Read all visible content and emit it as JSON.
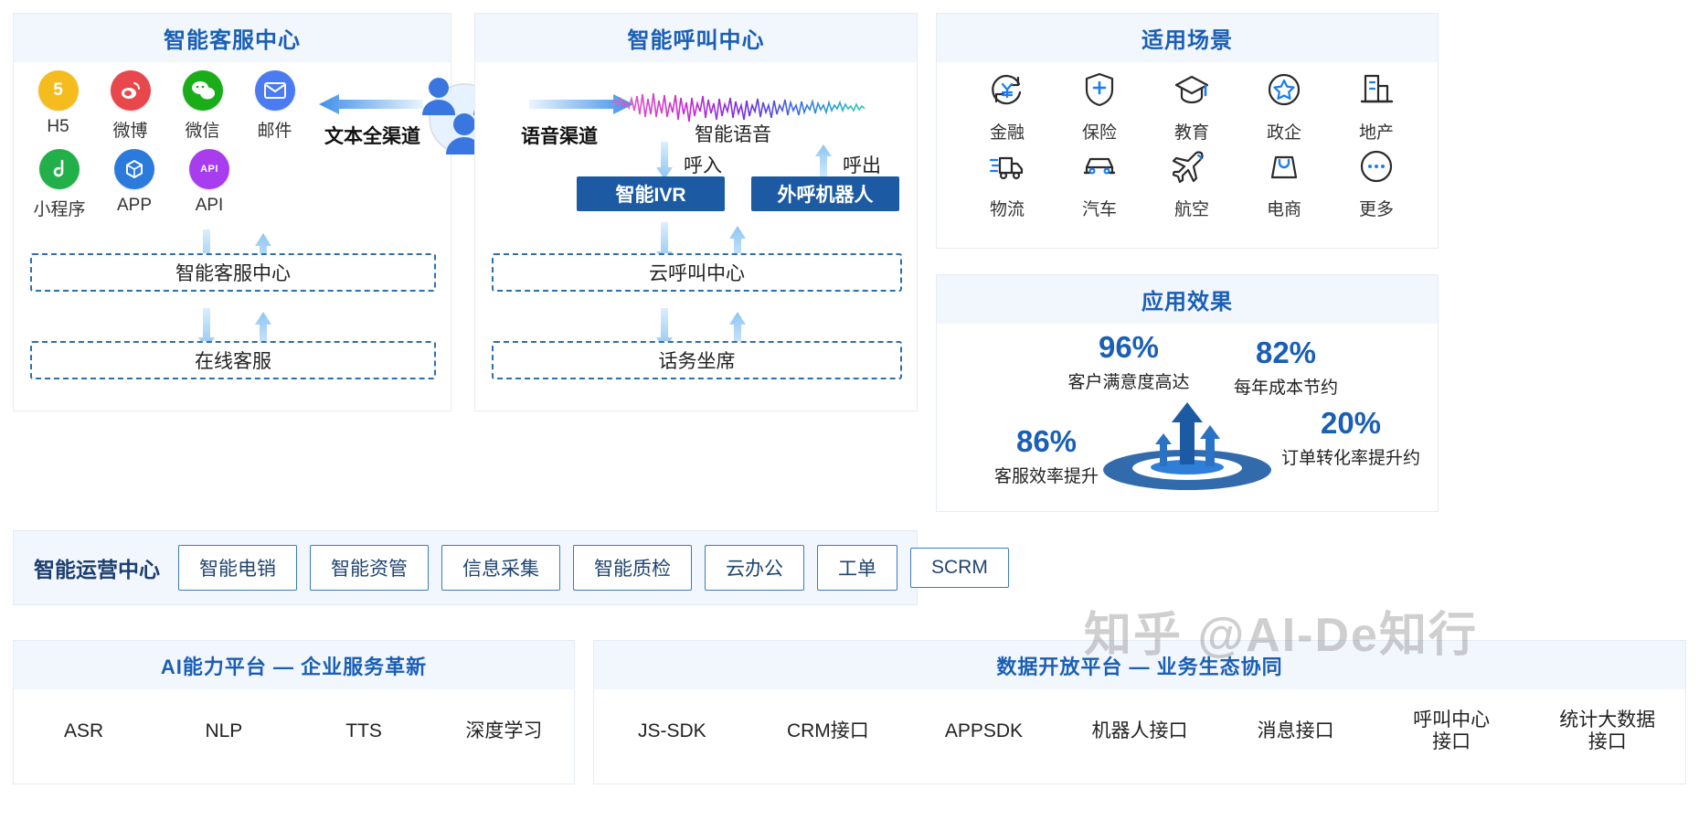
{
  "colors": {
    "brand_blue": "#1a5fb4",
    "deep_blue": "#1c5ba3",
    "panel_head_bg": "#f2f6fd",
    "dashed_border": "#2a6fb0",
    "arrow_light": "#a8cdf0"
  },
  "service_center": {
    "title": "智能客服中心",
    "channels_row1": [
      {
        "label": "H5",
        "icon": "h5-icon",
        "color": "#f5bc1e",
        "glyph": "5"
      },
      {
        "label": "微博",
        "icon": "weibo-icon",
        "color": "#e8474c",
        "glyph": "◉"
      },
      {
        "label": "微信",
        "icon": "wechat-icon",
        "color": "#1aad19",
        "glyph": "💬"
      },
      {
        "label": "邮件",
        "icon": "mail-icon",
        "color": "#4a7bf0",
        "glyph": "✉"
      }
    ],
    "channels_row2": [
      {
        "label": "小程序",
        "icon": "miniprogram-icon",
        "color": "#22b04a",
        "glyph": "♪"
      },
      {
        "label": "APP",
        "icon": "app-icon",
        "color": "#2a7bdc",
        "glyph": "◈"
      },
      {
        "label": "API",
        "icon": "api-icon",
        "color": "#a83df0",
        "glyph": "API"
      }
    ],
    "flow_label": "文本全渠道",
    "layer1": "智能客服中心",
    "layer2": "在线客服"
  },
  "call_center": {
    "title": "智能呼叫中心",
    "flow_label": "语音渠道",
    "voice_label": "智能语音",
    "inbound_label": "呼入",
    "outbound_label": "呼出",
    "ivr_box": "智能IVR",
    "robot_box": "外呼机器人",
    "layer1": "云呼叫中心",
    "layer2": "话务坐席"
  },
  "scenarios": {
    "title": "适用场景",
    "row1": [
      {
        "label": "金融",
        "icon": "yuan-refresh-icon"
      },
      {
        "label": "保险",
        "icon": "shield-plus-icon"
      },
      {
        "label": "教育",
        "icon": "graduation-cap-icon"
      },
      {
        "label": "政企",
        "icon": "star-circle-icon"
      },
      {
        "label": "地产",
        "icon": "building-icon"
      }
    ],
    "row2": [
      {
        "label": "物流",
        "icon": "truck-icon"
      },
      {
        "label": "汽车",
        "icon": "car-icon"
      },
      {
        "label": "航空",
        "icon": "airplane-icon"
      },
      {
        "label": "电商",
        "icon": "shopping-bag-icon"
      },
      {
        "label": "更多",
        "icon": "more-dots-icon"
      }
    ]
  },
  "effects": {
    "title": "应用效果",
    "items": [
      {
        "value": "96%",
        "label": "客户满意度高达"
      },
      {
        "value": "82%",
        "label": "每年成本节约"
      },
      {
        "value": "86%",
        "label": "客服效率提升"
      },
      {
        "value": "20%",
        "label": "订单转化率提升约"
      }
    ]
  },
  "operations": {
    "title": "智能运营中心",
    "items": [
      "智能电销",
      "智能资管",
      "信息采集",
      "智能质检",
      "云办公",
      "工单",
      "SCRM"
    ]
  },
  "ai_platform": {
    "title": "AI能力平台 — 企业服务革新",
    "items": [
      "ASR",
      "NLP",
      "TTS",
      "深度学习"
    ]
  },
  "data_platform": {
    "title": "数据开放平台 — 业务生态协同",
    "items": [
      "JS-SDK",
      "CRM接口",
      "APPSDK",
      "机器人接口",
      "消息接口",
      "呼叫中心\n接口",
      "统计大数据\n接口"
    ]
  },
  "watermark": "知乎 @AI-De知行"
}
